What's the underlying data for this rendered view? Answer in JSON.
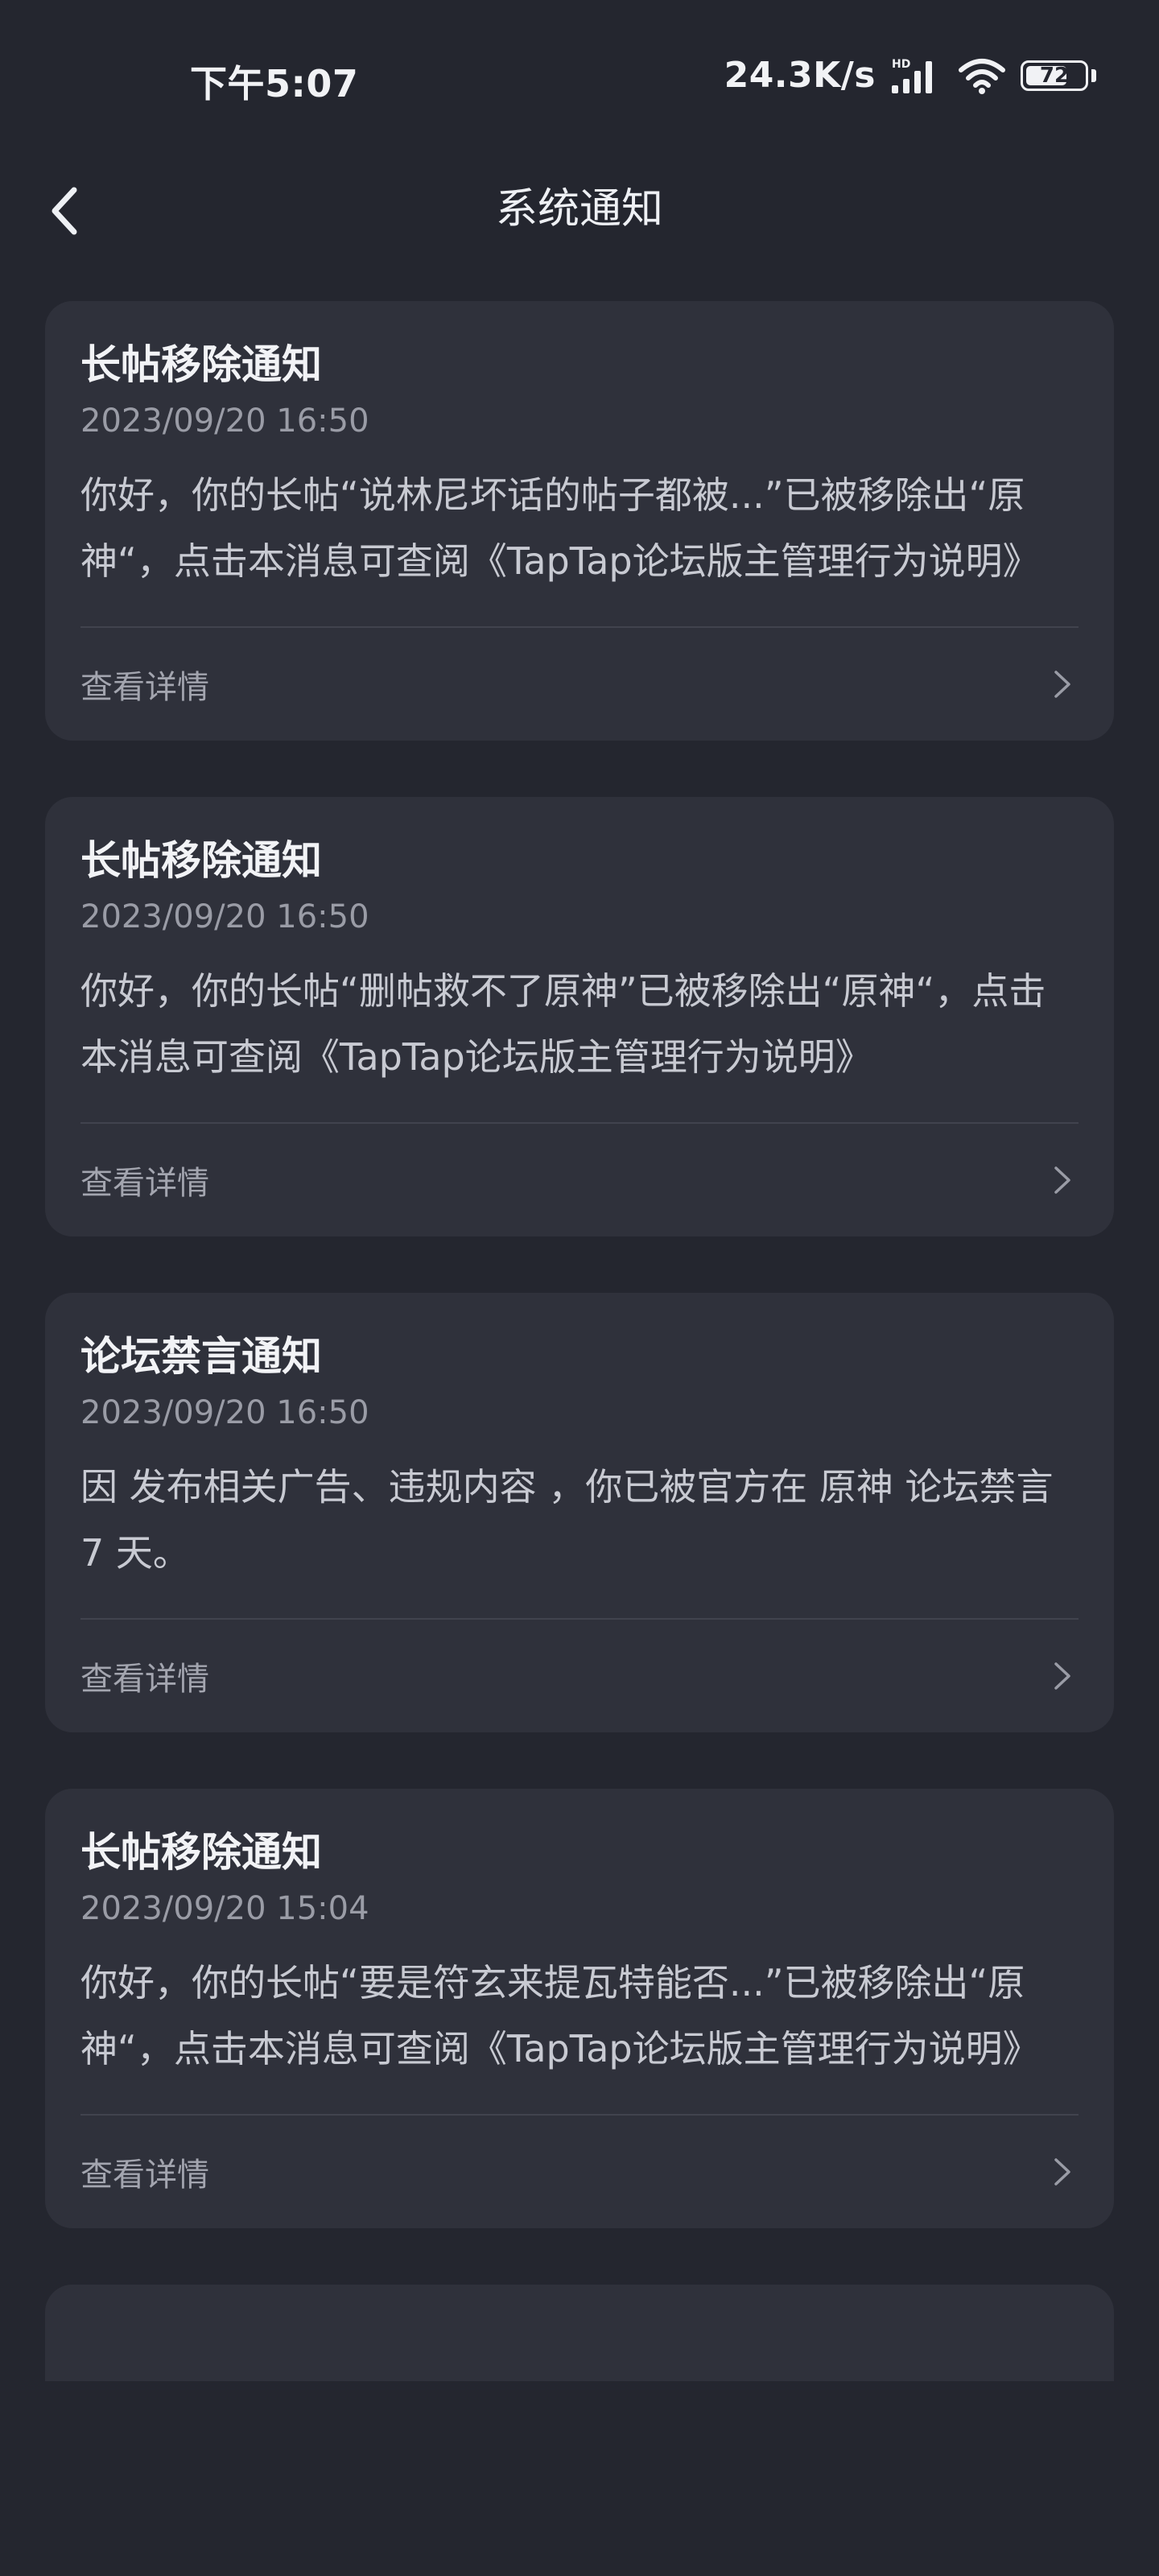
{
  "status_bar": {
    "time": "下午5:07",
    "network_speed": "24.3K/s",
    "signal_badge": "HD",
    "battery_level": 72,
    "battery_text": "72"
  },
  "nav": {
    "title": "系统通知"
  },
  "detail_label": "查看详情",
  "notifications": [
    {
      "title": "长帖移除通知",
      "date": "2023/09/20 16:50",
      "body": "你好，你的长帖“说林尼坏话的帖子都被...”已被移除出“原神“，点击本消息可查阅《TapTap论坛版主管理行为说明》"
    },
    {
      "title": "长帖移除通知",
      "date": "2023/09/20 16:50",
      "body": "你好，你的长帖“删帖救不了原神”已被移除出“原神“，点击本消息可查阅《TapTap论坛版主管理行为说明》"
    },
    {
      "title": "论坛禁言通知",
      "date": "2023/09/20 16:50",
      "body": "因 发布相关广告、违规内容 ，你已被官方在 原神 论坛禁言 7 天。"
    },
    {
      "title": "长帖移除通知",
      "date": "2023/09/20 15:04",
      "body": "你好，你的长帖“要是符玄来提瓦特能否...”已被移除出“原神“，点击本消息可查阅《TapTap论坛版主管理行为说明》"
    }
  ],
  "colors": {
    "background": "#24262f",
    "card": "#2f313b",
    "divider": "#41434e",
    "title": "#f2f3f6",
    "muted": "#9a9ca6"
  }
}
